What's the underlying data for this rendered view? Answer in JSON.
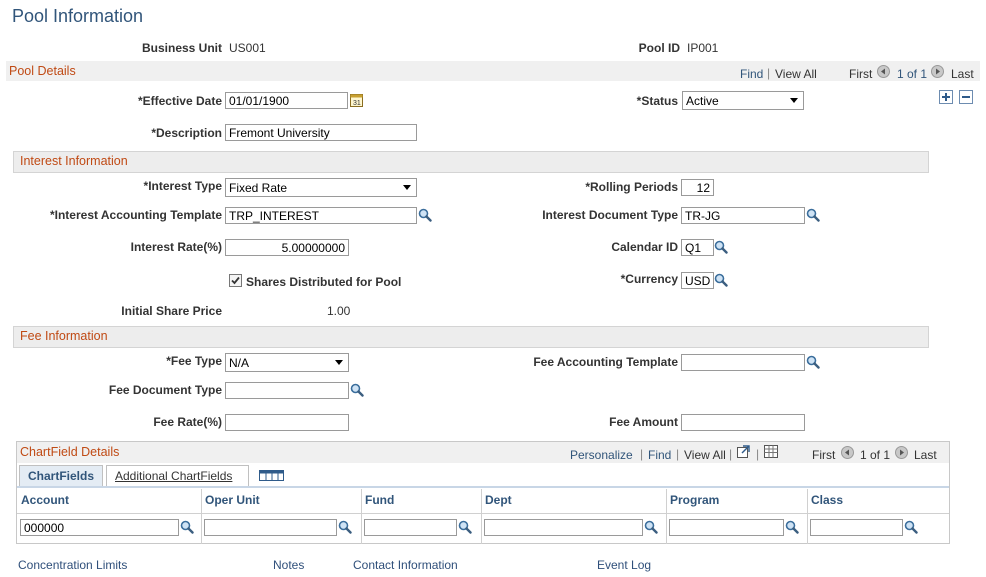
{
  "page_title": "Pool Information",
  "header": {
    "business_unit_label": "Business Unit",
    "business_unit_value": "US001",
    "pool_id_label": "Pool ID",
    "pool_id_value": "IP001"
  },
  "pool_details": {
    "title": "Pool Details",
    "find": "Find",
    "sep": "|",
    "view_all": "View All",
    "first": "First",
    "count": "1 of 1",
    "last": "Last",
    "effective_date_label": "*Effective Date",
    "effective_date_value": "01/01/1900",
    "status_label": "*Status",
    "status_value": "Active",
    "description_label": "*Description",
    "description_value": "Fremont University"
  },
  "interest": {
    "title": "Interest Information",
    "interest_type_label": "*Interest Type",
    "interest_type_value": "Fixed Rate",
    "rolling_periods_label": "*Rolling Periods",
    "rolling_periods_value": "12",
    "accounting_template_label": "*Interest Accounting Template",
    "accounting_template_value": "TRP_INTEREST",
    "document_type_label": "Interest Document Type",
    "document_type_value": "TR-JG",
    "rate_label": "Interest Rate(%)",
    "rate_value": "5.00000000",
    "calendar_label": "Calendar ID",
    "calendar_value": "Q1",
    "shares_label": "Shares Distributed for Pool",
    "shares_checked": true,
    "currency_label": "*Currency",
    "currency_value": "USD",
    "share_price_label": "Initial Share Price",
    "share_price_value": "1.00"
  },
  "fee": {
    "title": "Fee Information",
    "fee_type_label": "*Fee Type",
    "fee_type_value": "N/A",
    "accounting_template_label": "Fee Accounting Template",
    "accounting_template_value": "",
    "document_type_label": "Fee Document Type",
    "document_type_value": "",
    "rate_label": "Fee Rate(%)",
    "rate_value": "",
    "amount_label": "Fee Amount",
    "amount_value": ""
  },
  "chartfield": {
    "title": "ChartField Details",
    "personalize": "Personalize",
    "find": "Find",
    "view_all": "View All",
    "first": "First",
    "count": "1 of 1",
    "last": "Last",
    "sep": "|",
    "tabs": [
      "ChartFields",
      "Additional ChartFields"
    ],
    "columns": [
      "Account",
      "Oper Unit",
      "Fund",
      "Dept",
      "Program",
      "Class"
    ],
    "row": [
      "000000",
      "",
      "",
      "",
      "",
      ""
    ]
  },
  "footer_links": [
    "Concentration Limits",
    "Notes",
    "Contact Information",
    "Event Log"
  ],
  "icons": {
    "lookup": "magnifier-icon",
    "calendar": "calendar-icon",
    "add": "plus-icon",
    "delete": "minus-icon",
    "nav_prev": "arrow-left-circle-icon",
    "nav_next": "arrow-right-circle-icon",
    "new_window": "new-window-icon",
    "download": "grid-download-icon",
    "show_all_columns": "show-all-columns-icon"
  },
  "colors": {
    "title": "#31557a",
    "section_header": "#c04a14",
    "link": "#31557a"
  }
}
